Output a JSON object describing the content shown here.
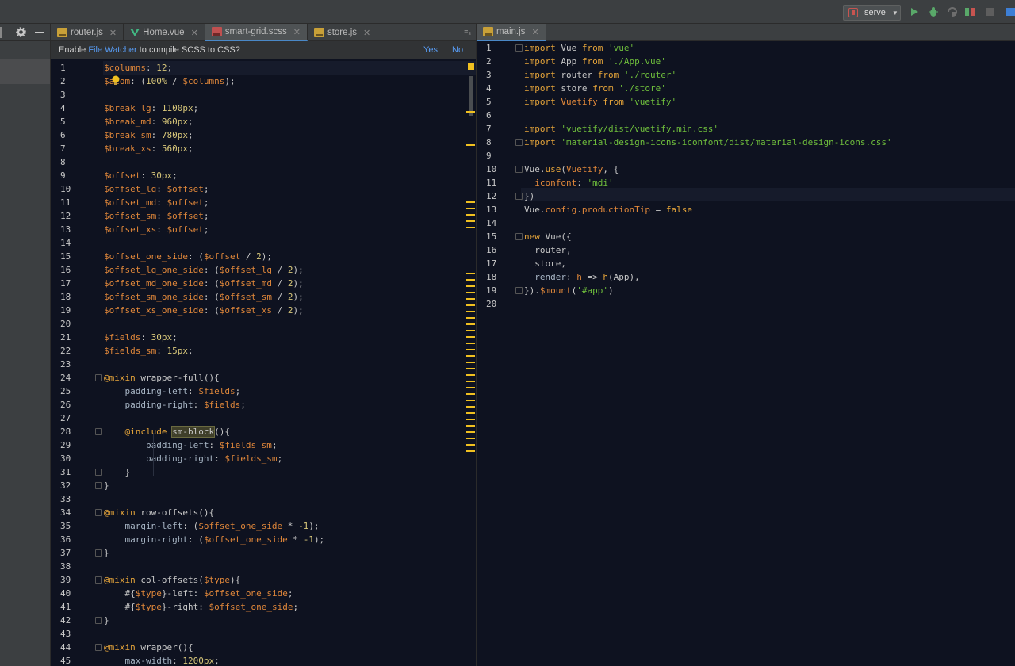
{
  "toolbar": {
    "run_config": "serve",
    "icons": [
      "run-icon",
      "debug-icon",
      "coverage-icon",
      "profile-icon",
      "stop-icon",
      "project-structure-icon"
    ]
  },
  "left_panel": {
    "icons": [
      "settings-icon",
      "minimize-icon"
    ]
  },
  "left_tabs": [
    {
      "label": "router.js",
      "icon": "js-file-icon",
      "active": false
    },
    {
      "label": "Home.vue",
      "icon": "vue-file-icon",
      "active": false
    },
    {
      "label": "smart-grid.scss",
      "icon": "scss-file-icon",
      "active": true
    },
    {
      "label": "store.js",
      "icon": "js-file-icon",
      "active": false
    }
  ],
  "left_tab_overflow": "≡₃",
  "right_tabs": [
    {
      "label": "main.js",
      "icon": "js-file-icon",
      "active": true
    }
  ],
  "notification": {
    "prefix": "Enable ",
    "link": "File Watcher",
    "suffix": " to compile SCSS to CSS?",
    "yes": "Yes",
    "no": "No"
  },
  "scss_lines": [
    [
      [
        "$columns",
        "var"
      ],
      [
        ": ",
        "op"
      ],
      [
        "12",
        "num"
      ],
      [
        ";",
        "op"
      ]
    ],
    [
      [
        "$atom",
        "var"
      ],
      [
        ": (",
        "op"
      ],
      [
        "100%",
        "num"
      ],
      [
        " / ",
        "op"
      ],
      [
        "$columns",
        "var"
      ],
      [
        ");",
        "op"
      ]
    ],
    [],
    [
      [
        "$break_lg",
        "var"
      ],
      [
        ": ",
        "op"
      ],
      [
        "1100",
        "num"
      ],
      [
        "px",
        "unit"
      ],
      [
        ";",
        "op"
      ]
    ],
    [
      [
        "$break_md",
        "var"
      ],
      [
        ": ",
        "op"
      ],
      [
        "960",
        "num"
      ],
      [
        "px",
        "unit"
      ],
      [
        ";",
        "op"
      ]
    ],
    [
      [
        "$break_sm",
        "var"
      ],
      [
        ": ",
        "op"
      ],
      [
        "780",
        "num"
      ],
      [
        "px",
        "unit"
      ],
      [
        ";",
        "op"
      ]
    ],
    [
      [
        "$break_xs",
        "var"
      ],
      [
        ": ",
        "op"
      ],
      [
        "560",
        "num"
      ],
      [
        "px",
        "unit"
      ],
      [
        ";",
        "op"
      ]
    ],
    [],
    [
      [
        "$offset",
        "var"
      ],
      [
        ": ",
        "op"
      ],
      [
        "30",
        "num"
      ],
      [
        "px",
        "unit"
      ],
      [
        ";",
        "op"
      ]
    ],
    [
      [
        "$offset_lg",
        "var"
      ],
      [
        ": ",
        "op"
      ],
      [
        "$offset",
        "var"
      ],
      [
        ";",
        "op"
      ]
    ],
    [
      [
        "$offset_md",
        "var"
      ],
      [
        ": ",
        "op"
      ],
      [
        "$offset",
        "var"
      ],
      [
        ";",
        "op"
      ]
    ],
    [
      [
        "$offset_sm",
        "var"
      ],
      [
        ": ",
        "op"
      ],
      [
        "$offset",
        "var"
      ],
      [
        ";",
        "op"
      ]
    ],
    [
      [
        "$offset_xs",
        "var"
      ],
      [
        ": ",
        "op"
      ],
      [
        "$offset",
        "var"
      ],
      [
        ";",
        "op"
      ]
    ],
    [],
    [
      [
        "$offset_one_side",
        "var"
      ],
      [
        ": (",
        "op"
      ],
      [
        "$offset",
        "var"
      ],
      [
        " / ",
        "op"
      ],
      [
        "2",
        "num"
      ],
      [
        ");",
        "op"
      ]
    ],
    [
      [
        "$offset_lg_one_side",
        "var"
      ],
      [
        ": (",
        "op"
      ],
      [
        "$offset_lg",
        "var"
      ],
      [
        " / ",
        "op"
      ],
      [
        "2",
        "num"
      ],
      [
        ");",
        "op"
      ]
    ],
    [
      [
        "$offset_md_one_side",
        "var"
      ],
      [
        ": (",
        "op"
      ],
      [
        "$offset_md",
        "var"
      ],
      [
        " / ",
        "op"
      ],
      [
        "2",
        "num"
      ],
      [
        ");",
        "op"
      ]
    ],
    [
      [
        "$offset_sm_one_side",
        "var"
      ],
      [
        ": (",
        "op"
      ],
      [
        "$offset_sm",
        "var"
      ],
      [
        " / ",
        "op"
      ],
      [
        "2",
        "num"
      ],
      [
        ");",
        "op"
      ]
    ],
    [
      [
        "$offset_xs_one_side",
        "var"
      ],
      [
        ": (",
        "op"
      ],
      [
        "$offset_xs",
        "var"
      ],
      [
        " / ",
        "op"
      ],
      [
        "2",
        "num"
      ],
      [
        ");",
        "op"
      ]
    ],
    [],
    [
      [
        "$fields",
        "var"
      ],
      [
        ": ",
        "op"
      ],
      [
        "30",
        "num"
      ],
      [
        "px",
        "unit"
      ],
      [
        ";",
        "op"
      ]
    ],
    [
      [
        "$fields_sm",
        "var"
      ],
      [
        ": ",
        "op"
      ],
      [
        "15",
        "num"
      ],
      [
        "px",
        "unit"
      ],
      [
        ";",
        "op"
      ]
    ],
    [],
    [
      [
        "@mixin",
        "kw"
      ],
      [
        " wrapper-full(){",
        "plain"
      ]
    ],
    [
      [
        "    padding-left",
        "prop"
      ],
      [
        ": ",
        "op"
      ],
      [
        "$fields",
        "var"
      ],
      [
        ";",
        "op"
      ]
    ],
    [
      [
        "    padding-right",
        "prop"
      ],
      [
        ": ",
        "op"
      ],
      [
        "$fields",
        "var"
      ],
      [
        ";",
        "op"
      ]
    ],
    [],
    [
      [
        "    ",
        "plain"
      ],
      [
        "@include",
        "kw"
      ],
      [
        " ",
        "plain"
      ],
      [
        "sm-block",
        "hl"
      ],
      [
        "(){",
        "plain"
      ]
    ],
    [
      [
        "        padding-left",
        "prop"
      ],
      [
        ": ",
        "op"
      ],
      [
        "$fields_sm",
        "var"
      ],
      [
        ";",
        "op"
      ]
    ],
    [
      [
        "        padding-right",
        "prop"
      ],
      [
        ": ",
        "op"
      ],
      [
        "$fields_sm",
        "var"
      ],
      [
        ";",
        "op"
      ]
    ],
    [
      [
        "    }",
        "plain"
      ]
    ],
    [
      [
        "}",
        "plain"
      ]
    ],
    [],
    [
      [
        "@mixin",
        "kw"
      ],
      [
        " row-offsets(){",
        "plain"
      ]
    ],
    [
      [
        "    margin-left",
        "prop"
      ],
      [
        ": (",
        "op"
      ],
      [
        "$offset_one_side",
        "var"
      ],
      [
        " * ",
        "op"
      ],
      [
        "-1",
        "num"
      ],
      [
        ");",
        "op"
      ]
    ],
    [
      [
        "    margin-right",
        "prop"
      ],
      [
        ": (",
        "op"
      ],
      [
        "$offset_one_side",
        "var"
      ],
      [
        " * ",
        "op"
      ],
      [
        "-1",
        "num"
      ],
      [
        ");",
        "op"
      ]
    ],
    [
      [
        "}",
        "plain"
      ]
    ],
    [],
    [
      [
        "@mixin",
        "kw"
      ],
      [
        " col-offsets(",
        "plain"
      ],
      [
        "$type",
        "var"
      ],
      [
        "){",
        "plain"
      ]
    ],
    [
      [
        "    #{",
        "plain"
      ],
      [
        "$type",
        "var"
      ],
      [
        "}-left",
        "plain"
      ],
      [
        ": ",
        "op"
      ],
      [
        "$offset_one_side",
        "var"
      ],
      [
        ";",
        "op"
      ]
    ],
    [
      [
        "    #{",
        "plain"
      ],
      [
        "$type",
        "var"
      ],
      [
        "}-right",
        "plain"
      ],
      [
        ": ",
        "op"
      ],
      [
        "$offset_one_side",
        "var"
      ],
      [
        ";",
        "op"
      ]
    ],
    [
      [
        "}",
        "plain"
      ]
    ],
    [],
    [
      [
        "@mixin",
        "kw"
      ],
      [
        " wrapper(){",
        "plain"
      ]
    ],
    [
      [
        "    max-width",
        "prop"
      ],
      [
        ": ",
        "op"
      ],
      [
        "1200",
        "num"
      ],
      [
        "px",
        "unit"
      ],
      [
        ";",
        "op"
      ]
    ]
  ],
  "js_lines": [
    [
      [
        "import",
        "kw"
      ],
      [
        " Vue ",
        "plain"
      ],
      [
        "from",
        "kw"
      ],
      [
        " ",
        "plain"
      ],
      [
        "'vue'",
        "str"
      ]
    ],
    [
      [
        "import",
        "kw"
      ],
      [
        " App ",
        "plain"
      ],
      [
        "from",
        "kw"
      ],
      [
        " ",
        "plain"
      ],
      [
        "'./App.vue'",
        "str"
      ]
    ],
    [
      [
        "import",
        "kw"
      ],
      [
        " router ",
        "plain"
      ],
      [
        "from",
        "kw"
      ],
      [
        " ",
        "plain"
      ],
      [
        "'./router'",
        "str"
      ]
    ],
    [
      [
        "import",
        "kw"
      ],
      [
        " store ",
        "plain"
      ],
      [
        "from",
        "kw"
      ],
      [
        " ",
        "plain"
      ],
      [
        "'./store'",
        "str"
      ]
    ],
    [
      [
        "import",
        "kw"
      ],
      [
        " ",
        "plain"
      ],
      [
        "Vuetify",
        "var"
      ],
      [
        " ",
        "plain"
      ],
      [
        "from",
        "kw"
      ],
      [
        " ",
        "plain"
      ],
      [
        "'vuetify'",
        "str"
      ]
    ],
    [],
    [
      [
        "import",
        "kw"
      ],
      [
        " ",
        "plain"
      ],
      [
        "'vuetify/dist/vuetify.min.css'",
        "str"
      ]
    ],
    [
      [
        "import",
        "kw"
      ],
      [
        " ",
        "plain"
      ],
      [
        "'material-design-icons-iconfont/dist/material-design-icons.css'",
        "str"
      ]
    ],
    [],
    [
      [
        "Vue.",
        "plain"
      ],
      [
        "use",
        "fn"
      ],
      [
        "(",
        "plain"
      ],
      [
        "Vuetify",
        "var"
      ],
      [
        ", {",
        "plain"
      ]
    ],
    [
      [
        "  ",
        "plain"
      ],
      [
        "iconfont",
        "var"
      ],
      [
        ": ",
        "plain"
      ],
      [
        "'mdi'",
        "str"
      ]
    ],
    [
      [
        "})",
        "plain"
      ]
    ],
    [
      [
        "Vue.",
        "plain"
      ],
      [
        "config",
        "var"
      ],
      [
        ".",
        "plain"
      ],
      [
        "productionTip",
        "var"
      ],
      [
        " = ",
        "plain"
      ],
      [
        "false",
        "kw"
      ]
    ],
    [],
    [
      [
        "new",
        "kw"
      ],
      [
        " Vue({",
        "plain"
      ]
    ],
    [
      [
        "  router,",
        "plain"
      ]
    ],
    [
      [
        "  store,",
        "plain"
      ]
    ],
    [
      [
        "  render",
        "prop"
      ],
      [
        ": ",
        "plain"
      ],
      [
        "h",
        "var"
      ],
      [
        " => ",
        "plain"
      ],
      [
        "h",
        "fn"
      ],
      [
        "(App),",
        "plain"
      ]
    ],
    [
      [
        "}).",
        "plain"
      ],
      [
        "$mount",
        "var"
      ],
      [
        "(",
        "plain"
      ],
      [
        "'#app'",
        "str"
      ],
      [
        ")",
        "plain"
      ]
    ],
    []
  ]
}
